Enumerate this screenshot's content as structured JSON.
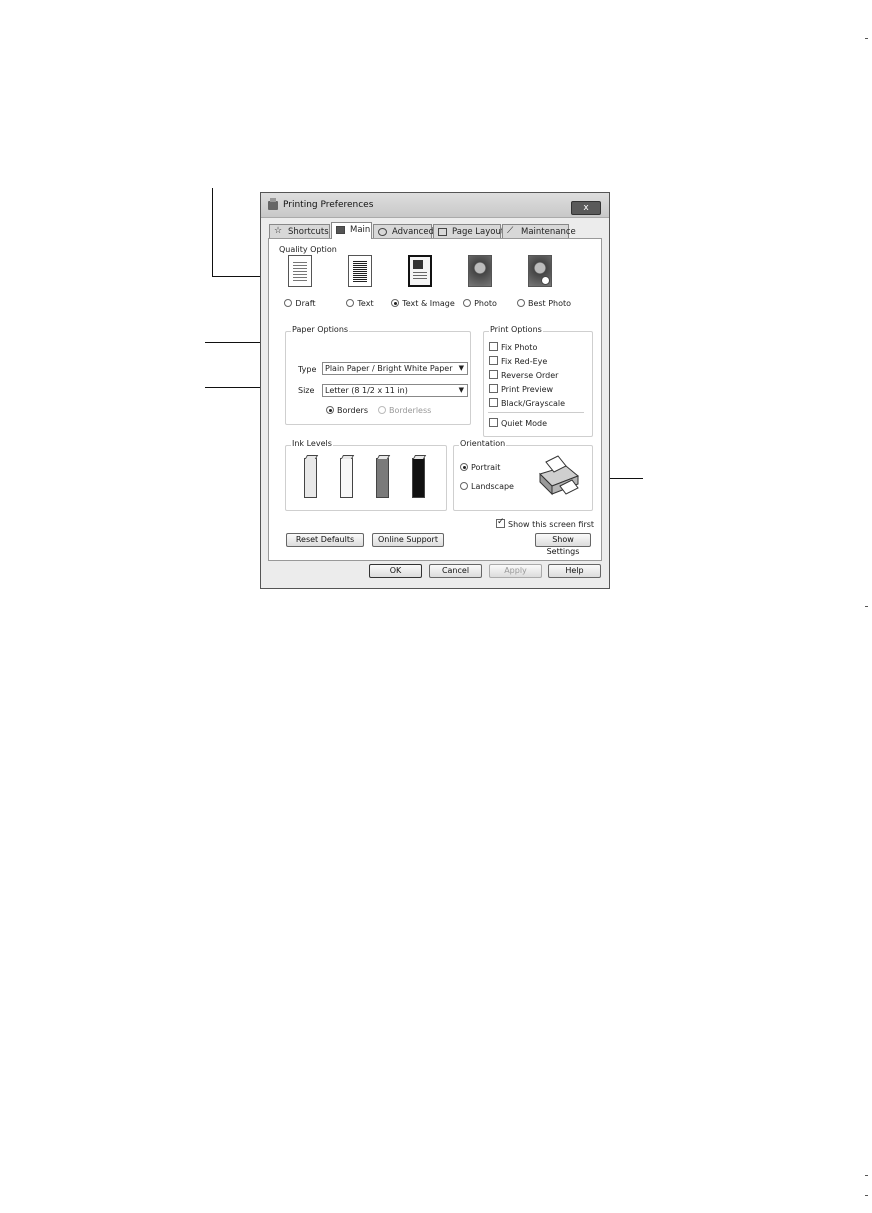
{
  "window": {
    "title": "Printing Preferences",
    "close_label": "x"
  },
  "tabs": [
    {
      "label": "Shortcuts",
      "icon": "star-icon"
    },
    {
      "label": "Main",
      "icon": "printer-icon"
    },
    {
      "label": "Advanced",
      "icon": "settings-icon"
    },
    {
      "label": "Page Layout",
      "icon": "page-layout-icon"
    },
    {
      "label": "Maintenance",
      "icon": "wrench-icon"
    }
  ],
  "active_tab": "Main",
  "quality_option": {
    "label": "Quality Option",
    "options": [
      {
        "label": "Draft",
        "selected": false
      },
      {
        "label": "Text",
        "selected": false
      },
      {
        "label": "Text & Image",
        "selected": true
      },
      {
        "label": "Photo",
        "selected": false
      },
      {
        "label": "Best Photo",
        "selected": false
      }
    ]
  },
  "paper_options": {
    "label": "Paper Options",
    "type_label": "Type",
    "type_value": "Plain Paper / Bright White Paper",
    "size_label": "Size",
    "size_value": "Letter (8 1/2 x 11 in)",
    "borders_label": "Borders",
    "borderless_label": "Borderless",
    "borders_selected": true
  },
  "print_options": {
    "label": "Print Options",
    "items": [
      {
        "label": "Fix Photo",
        "checked": false
      },
      {
        "label": "Fix Red-Eye",
        "checked": false
      },
      {
        "label": "Reverse Order",
        "checked": false
      },
      {
        "label": "Print Preview",
        "checked": false
      },
      {
        "label": "Black/Grayscale",
        "checked": false
      }
    ],
    "quiet_mode_label": "Quiet Mode",
    "quiet_mode_checked": false
  },
  "ink_levels": {
    "label": "Ink Levels",
    "colors": [
      "#e8e8e8",
      "#f7f7f7",
      "#7a7a7a",
      "#111111"
    ]
  },
  "orientation": {
    "label": "Orientation",
    "portrait_label": "Portrait",
    "landscape_label": "Landscape",
    "portrait_selected": true
  },
  "show_screen_first": {
    "label": "Show this screen first",
    "checked": true
  },
  "buttons": {
    "reset_defaults": "Reset Defaults",
    "online_support": "Online Support",
    "show_settings": "Show Settings",
    "ok": "OK",
    "cancel": "Cancel",
    "apply": "Apply",
    "help": "Help"
  }
}
